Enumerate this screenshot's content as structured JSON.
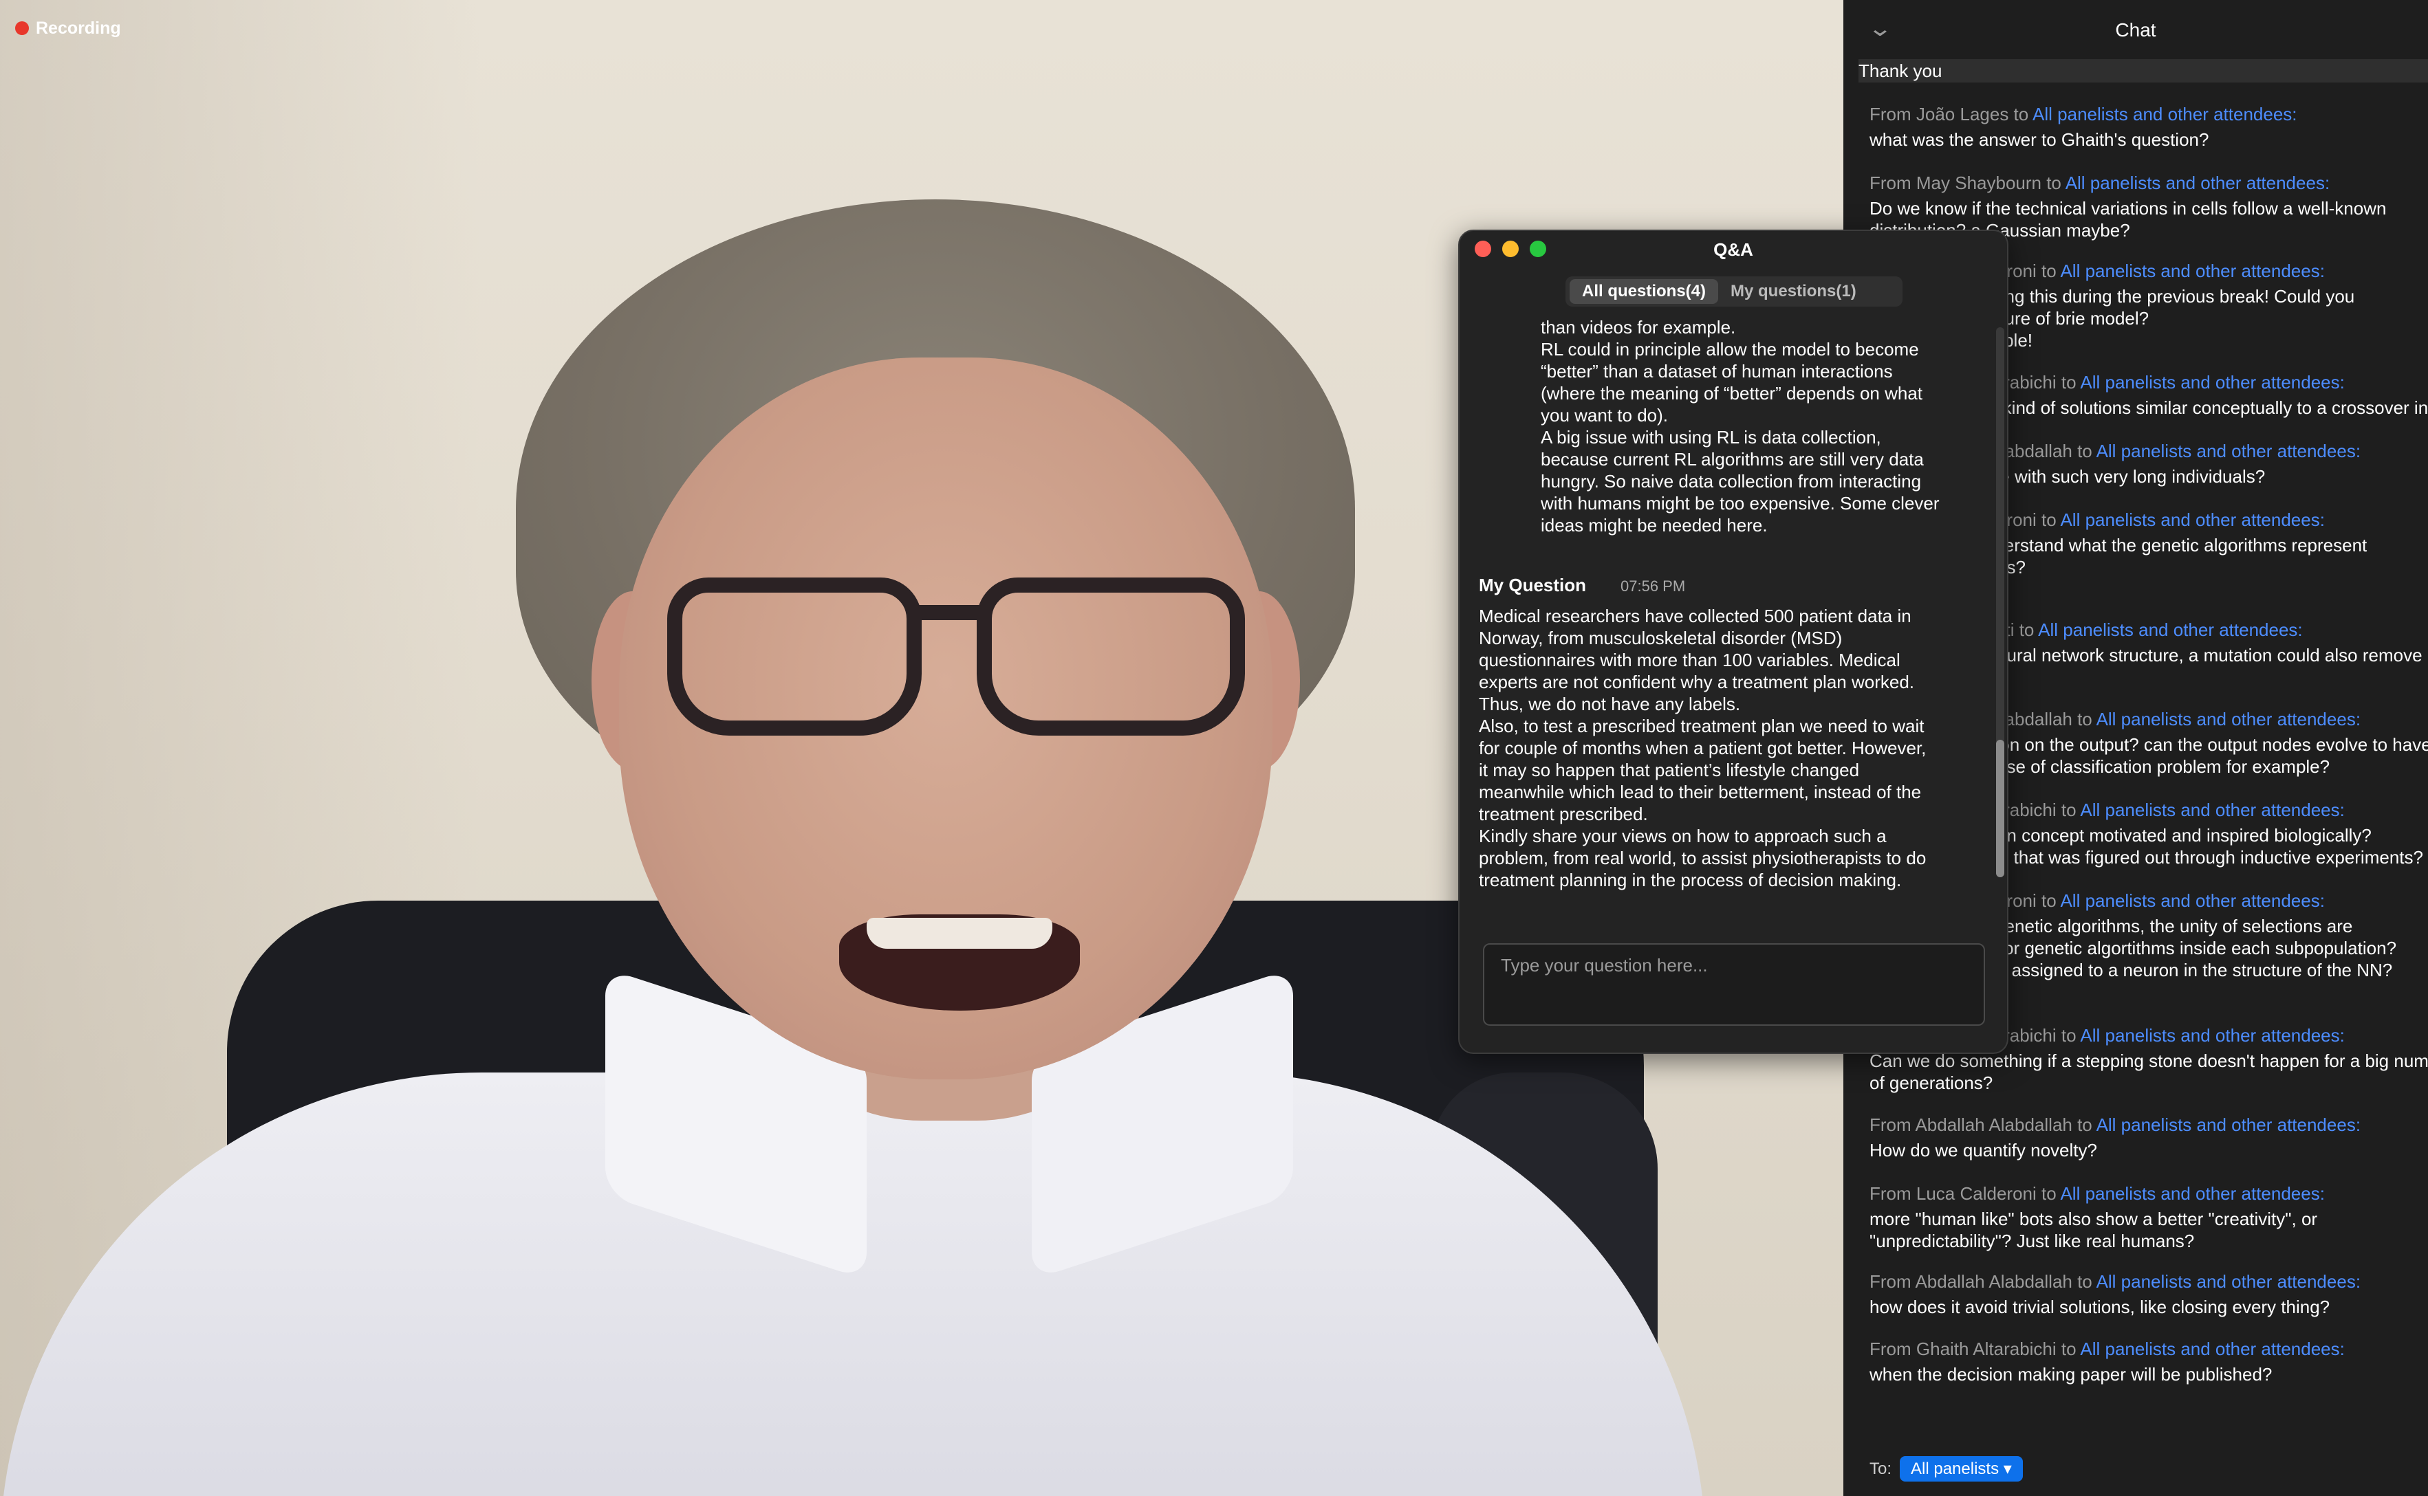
{
  "recording": {
    "label": "Recording"
  },
  "chat": {
    "title": "Chat",
    "highlight": "Thank you",
    "messages": [
      {
        "from": "From João Lages to ",
        "to": "All panelists and other attendees:",
        "body": "what was the answer to Ghaith's question?"
      },
      {
        "from": "From May Shaybourn to ",
        "to": "All panelists and other attendees:",
        "body": "Do we know if the technical variations in cells follow a well-known\ndistribution? a Gaussian maybe?"
      },
      {
        "from": "From Luca Calderoni to ",
        "to": "All panelists and other attendees:",
        "body": "Sorry for not asking this during the previous break! Could you\nexplain the structure of brie model?\nSorry for the trouble!"
      },
      {
        "from": "From Ghaith Altarabichi to ",
        "to": "All panelists and other attendees:",
        "body": "Can we use any kind of solutions similar conceptually to a crossover in EA?"
      },
      {
        "from": "From Abdallah Alabdallah to ",
        "to": "All panelists and other attendees:",
        "body": "How does it scale with such very long individuals?"
      },
      {
        "from": "From Luca Calderoni to ",
        "to": "All panelists and other attendees:",
        "body": "I didn't really understand what the genetic algorithms represent\nin the experiments?"
      },
      {
        "from": "From Sara Raffieti to ",
        "to": "All panelists and other attendees:",
        "body": "Regarding the neural network structure, a mutation could also remove\na connection?"
      },
      {
        "from": "From Abdallah Alabdallah to ",
        "to": "All panelists and other attendees:",
        "body": "Is there a limitation on the output? can the output nodes evolve to have\nmore nodes in case of classification problem for example?"
      },
      {
        "from": "From Ghaith Altarabichi to ",
        "to": "All panelists and other attendees:",
        "body": "Is the specification concept motivated and inspired biologically?\nOr is it something that was figured out through inductive experiments?"
      },
      {
        "from": "From Luca Calderoni to ",
        "to": "All panelists and other attendees:",
        "body": "If we talk about genetic algorithms, the unity of selections are\nthe individuals. For genetic algortithms inside each subpopulation?\nIs a single weight assigned to a neuron in the structure of the NN?\nThank you!"
      },
      {
        "from": "From Ghaith Altarabichi to ",
        "to": "All panelists and other attendees:",
        "body": "Can we do something if a stepping stone doesn't happen for a big number\nof generations?"
      },
      {
        "from": "From Abdallah Alabdallah to ",
        "to": "All panelists and other attendees:",
        "body": "How do we quantify novelty?"
      },
      {
        "from": "From Luca Calderoni to ",
        "to": "All panelists and other attendees:",
        "body": "more \"human like\" bots also show a better \"creativity\", or\n\"unpredictability\"? Just like real humans?"
      },
      {
        "from": "From Abdallah Alabdallah to ",
        "to": "All panelists and other attendees:",
        "body": "how does it avoid trivial solutions, like closing every thing?"
      },
      {
        "from": "From Ghaith Altarabichi to ",
        "to": "All panelists and other attendees:",
        "body": "when the decision making paper will be published?"
      }
    ],
    "to_label": "To:",
    "to_value": "All panelists"
  },
  "qa": {
    "title": "Q&A",
    "tabs": [
      "All questions(4)",
      "My questions(1)"
    ],
    "answer_text": "than videos for example.\nRL could in principle allow the model to become\n“better” than a dataset of human interactions\n(where the meaning of “better” depends on what\nyou want to do).\nA big issue with using RL is data collection,\nbecause current RL algorithms are still very data\nhungry. So naive data collection from interacting\nwith humans might be too expensive. Some clever\nideas might be needed here.",
    "my_question_label": "My Question",
    "my_question_time": "07:56 PM",
    "my_question_text": "Medical researchers have collected 500 patient data in\nNorway, from musculoskeletal disorder (MSD)\nquestionnaires with more than 100 variables. Medical\nexperts are not confident why a treatment plan worked.\nThus, we do not have any labels.\nAlso, to test a prescribed treatment plan we need to wait\nfor couple of months when a patient got better. However,\nit may so happen that patient’s lifestyle changed\nmeanwhile which lead to their betterment, instead of the\ntreatment prescribed.\nKindly share your views on how to approach such a\nproblem, from real world, to assist physiotherapists to do\ntreatment planning in the process of decision making.",
    "input_placeholder": "Type your question here..."
  }
}
